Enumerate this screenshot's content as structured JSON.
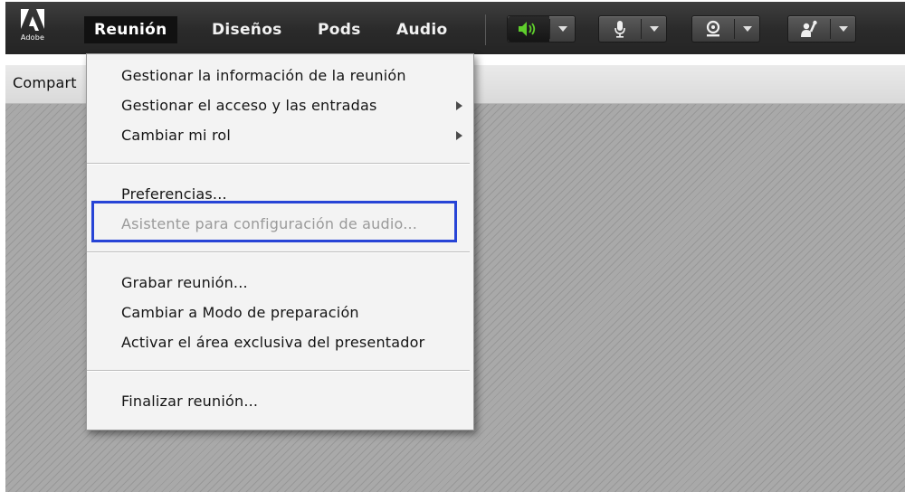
{
  "brand": {
    "logo_text": "Adobe",
    "logo_icon": "adobe-logo-icon"
  },
  "menubar": {
    "items": [
      {
        "label": "Reunión",
        "active": true
      },
      {
        "label": "Diseños",
        "active": false
      },
      {
        "label": "Pods",
        "active": false
      },
      {
        "label": "Audio",
        "active": false
      }
    ]
  },
  "controls": [
    {
      "icon": "speaker-icon",
      "state": "on",
      "color": "#5fce2c"
    },
    {
      "icon": "microphone-icon",
      "state": "off"
    },
    {
      "icon": "webcam-icon",
      "state": "off"
    },
    {
      "icon": "raise-hand-icon",
      "state": "off"
    }
  ],
  "subbar": {
    "label": "Compart"
  },
  "dropdown": {
    "groups": [
      [
        {
          "label": "Gestionar la información de la reunión",
          "submenu": false,
          "enabled": true
        },
        {
          "label": "Gestionar el acceso y las entradas",
          "submenu": true,
          "enabled": true
        },
        {
          "label": "Cambiar mi rol",
          "submenu": true,
          "enabled": true
        }
      ],
      [
        {
          "label": "Preferencias...",
          "submenu": false,
          "enabled": true
        },
        {
          "label": "Asistente para configuración de audio...",
          "submenu": false,
          "enabled": false,
          "highlighted": true
        }
      ],
      [
        {
          "label": "Grabar reunión...",
          "submenu": false,
          "enabled": true
        },
        {
          "label": "Cambiar a Modo de preparación",
          "submenu": false,
          "enabled": true
        },
        {
          "label": "Activar el área exclusiva del presentador",
          "submenu": false,
          "enabled": true
        }
      ],
      [
        {
          "label": "Finalizar reunión...",
          "submenu": false,
          "enabled": true
        }
      ]
    ]
  },
  "colors": {
    "highlight_box": "#2744d6",
    "speaker_active": "#5fce2c",
    "topbar": "#2e2e2e"
  }
}
